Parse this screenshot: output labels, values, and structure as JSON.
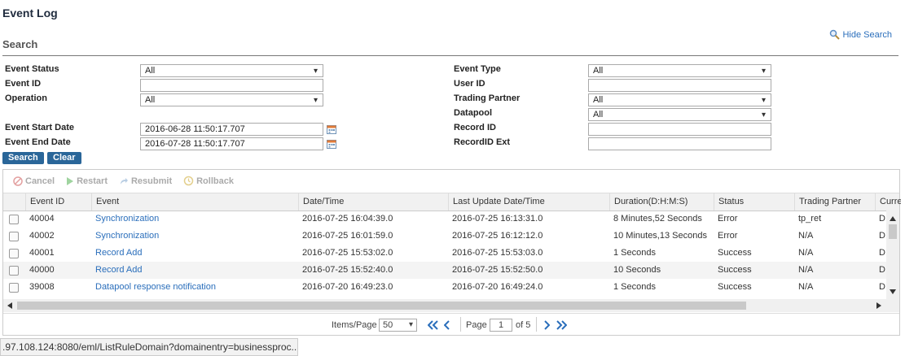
{
  "page": {
    "title": "Event Log",
    "search_heading": "Search",
    "hide_search": "Hide Search"
  },
  "form": {
    "event_status": {
      "label": "Event Status",
      "value": "All"
    },
    "event_id": {
      "label": "Event ID",
      "value": ""
    },
    "operation": {
      "label": "Operation",
      "value": "All"
    },
    "start_date": {
      "label": "Event Start Date",
      "value": "2016-06-28 11:50:17.707"
    },
    "end_date": {
      "label": "Event End Date",
      "value": "2016-07-28 11:50:17.707"
    },
    "event_type": {
      "label": "Event Type",
      "value": "All"
    },
    "user_id": {
      "label": "User ID",
      "value": ""
    },
    "trading_partner": {
      "label": "Trading Partner",
      "value": "All"
    },
    "datapool": {
      "label": "Datapool",
      "value": "All"
    },
    "record_id": {
      "label": "Record ID",
      "value": ""
    },
    "record_id_ext": {
      "label": "RecordID Ext",
      "value": ""
    },
    "search_btn": "Search",
    "clear_btn": "Clear"
  },
  "toolbar": {
    "cancel": "Cancel",
    "restart": "Restart",
    "resubmit": "Resubmit",
    "rollback": "Rollback"
  },
  "columns": [
    "Event ID",
    "Event",
    "Date/Time",
    "Last Update Date/Time",
    "Duration(D:H:M:S)",
    "Status",
    "Trading Partner",
    "Curre"
  ],
  "rows": [
    {
      "id": "40004",
      "event": "Synchronization",
      "date": "2016-07-25 16:04:39.0",
      "updated": "2016-07-25 16:13:31.0",
      "duration": "8 Minutes,52 Seconds",
      "status": "Error",
      "partner": "tp_ret",
      "curr": "D"
    },
    {
      "id": "40002",
      "event": "Synchronization",
      "date": "2016-07-25 16:01:59.0",
      "updated": "2016-07-25 16:12:12.0",
      "duration": "10 Minutes,13 Seconds",
      "status": "Error",
      "partner": "N/A",
      "curr": "D"
    },
    {
      "id": "40001",
      "event": "Record Add",
      "date": "2016-07-25 15:53:02.0",
      "updated": "2016-07-25 15:53:03.0",
      "duration": "1 Seconds",
      "status": "Success",
      "partner": "N/A",
      "curr": "D"
    },
    {
      "id": "40000",
      "event": "Record Add",
      "date": "2016-07-25 15:52:40.0",
      "updated": "2016-07-25 15:52:50.0",
      "duration": "10 Seconds",
      "status": "Success",
      "partner": "N/A",
      "curr": "D"
    },
    {
      "id": "39008",
      "event": "Datapool response notification",
      "date": "2016-07-20 16:49:23.0",
      "updated": "2016-07-20 16:49:24.0",
      "duration": "1 Seconds",
      "status": "Success",
      "partner": "N/A",
      "curr": "D"
    }
  ],
  "pager": {
    "items_label": "Items/Page",
    "items_value": "50",
    "page_label": "Page",
    "page_value": "1",
    "of_label": "of 5"
  },
  "statusbar": {
    "url": ".97.108.124:8080/eml/ListRuleDomain?domainentry=businessproc..."
  }
}
